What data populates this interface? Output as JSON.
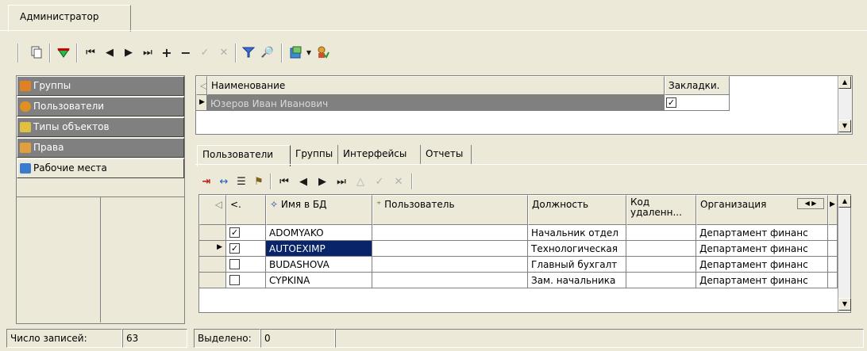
{
  "window_tab": "Администратор",
  "toolbar": {
    "icons": [
      "copy-icon",
      "refresh-gem-icon",
      "first-record-icon",
      "prev-record-icon",
      "next-record-icon",
      "last-record-icon",
      "add-icon",
      "remove-icon",
      "confirm-icon",
      "cancel-icon",
      "filter-icon",
      "find-icon",
      "export-icon",
      "dropdown-icon",
      "user-action-icon"
    ]
  },
  "nav": {
    "items": [
      {
        "label": "Группы",
        "icon": "groups-icon"
      },
      {
        "label": "Пользователи",
        "icon": "user-icon"
      },
      {
        "label": "Типы объектов",
        "icon": "object-types-icon"
      },
      {
        "label": "Права",
        "icon": "rights-icon"
      },
      {
        "label": "Рабочие места",
        "icon": "workplaces-icon"
      }
    ]
  },
  "top_grid": {
    "columns": [
      "Наименование",
      "Закладки."
    ],
    "rows": [
      {
        "name": "Юзеров Иван Иванович",
        "bookmarks": "✓"
      }
    ]
  },
  "subtabs": [
    "Пользователи",
    "Группы",
    "Интерфейсы",
    "Отчеты"
  ],
  "subtoolbar": {
    "icons": [
      "import-icon",
      "link-icon",
      "list-icon",
      "grant-icon",
      "first-record-icon",
      "prev-record-icon",
      "next-record-icon",
      "last-record-icon",
      "up-icon",
      "confirm-icon",
      "cancel-icon"
    ]
  },
  "users_grid": {
    "columns": [
      "<.",
      "Имя в БД",
      "Пользователь",
      "Должность",
      "Код удаленн...",
      "Организация"
    ],
    "rows": [
      {
        "checked": "✓",
        "db_name": "ADOMYAKO",
        "user": "",
        "position": "Начальник отдел",
        "code": "",
        "org": "Департамент финанс"
      },
      {
        "checked": "✓",
        "db_name": "AUTOEXIMP",
        "user": "",
        "position": "Технологическая",
        "code": "",
        "org": "Департамент финанс"
      },
      {
        "checked": "",
        "db_name": "BUDASHOVA",
        "user": "",
        "position": "Главный бухгалт",
        "code": "",
        "org": "Департамент финанс"
      },
      {
        "checked": "",
        "db_name": "CYPKINA",
        "user": "",
        "position": "Зам. начальника",
        "code": "",
        "org": "Департамент финанс"
      }
    ]
  },
  "status": {
    "records_label": "Число записей:",
    "records_value": "63",
    "selected_label": "Выделено:",
    "selected_value": "0"
  }
}
